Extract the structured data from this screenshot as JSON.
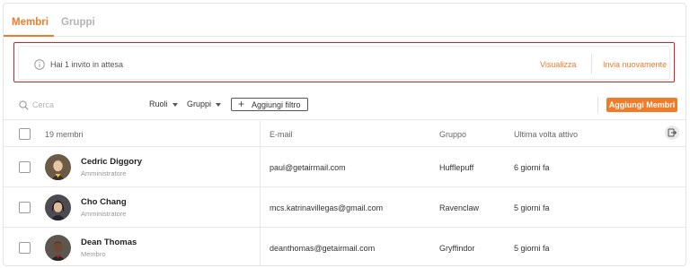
{
  "tabs": [
    {
      "label": "Membri",
      "active": true
    },
    {
      "label": "Gruppi",
      "active": false
    }
  ],
  "banner": {
    "text": "Hai 1 invito in attesa",
    "view_label": "Visualizza",
    "resend_label": "Invia nuovamente"
  },
  "toolbar": {
    "search_placeholder": "Cerca",
    "roles_label": "Ruoli",
    "groups_label": "Gruppi",
    "add_filter_label": "Aggiungi filtro",
    "add_members_label": "Aggiungi Membri"
  },
  "table": {
    "headers": {
      "members": "19 membri",
      "email": "E-mail",
      "group": "Gruppo",
      "last_active": "Ultima volta attivo"
    },
    "rows": [
      {
        "name": "Cedric Diggory",
        "role": "Amministratore",
        "email": "paul@getairmail.com",
        "group": "Hufflepuff",
        "last_active": "6 giorni fa"
      },
      {
        "name": "Cho Chang",
        "role": "Amministratore",
        "email": "mcs.katrinavillegas@gmail.com",
        "group": "Ravenclaw",
        "last_active": "5 giorni fa"
      },
      {
        "name": "Dean Thomas",
        "role": "Membro",
        "email": "deanthomas@getairmail.com",
        "group": "Gryffindor",
        "last_active": "5 giorni fa"
      }
    ]
  },
  "colors": {
    "accent": "#f07c2a",
    "highlight_border": "#e21b26"
  },
  "icons": {
    "info": "info-circle-icon",
    "search": "search-icon",
    "add_filter": "plus-icon",
    "export": "export-icon",
    "dropdown": "caret-down-icon"
  }
}
